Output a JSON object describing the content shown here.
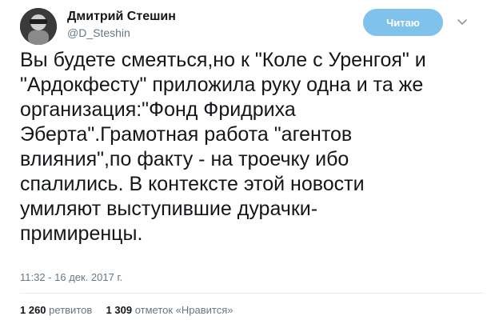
{
  "author": {
    "display_name": "Дмитрий Стешин",
    "handle": "@D_Steshin"
  },
  "follow_button": {
    "label": "Читаю"
  },
  "tweet": {
    "lines": [
      "Вы будете смеяться,но к \"Коле с Уренгоя\" и",
      "\"Ардокфесту\" приложила руку одна и та же",
      "организация:\"Фонд Фридриха",
      "Эберта\".Грамотная работа \"агентов",
      "влияния\",по факту - на троечку ибо",
      "спалились. В контексте этой новости",
      "умиляют выступившие дурачки-",
      "примиренцы."
    ],
    "timestamp": "11:32 - 16 дек. 2017 г."
  },
  "stats": {
    "retweets_count": "1 260",
    "retweets_label": "ретвитов",
    "likes_count": "1 309",
    "likes_label": "отметок «Нравится»"
  },
  "colors": {
    "follow_button_bg": "#7fc2ec",
    "secondary_text": "#657786",
    "primary_text": "#14171a"
  },
  "icons": {
    "avatar": "profile-photo",
    "more": "chevron-down-icon"
  }
}
